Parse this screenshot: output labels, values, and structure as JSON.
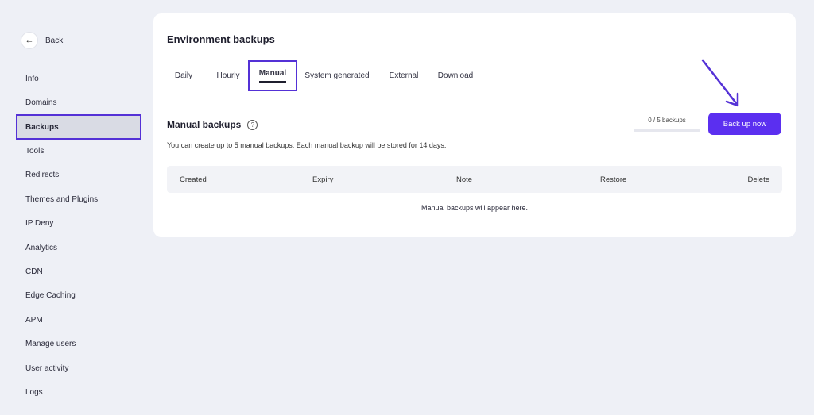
{
  "sidebar": {
    "back_label": "Back",
    "items": [
      {
        "label": "Info"
      },
      {
        "label": "Domains"
      },
      {
        "label": "Backups"
      },
      {
        "label": "Tools"
      },
      {
        "label": "Redirects"
      },
      {
        "label": "Themes and Plugins"
      },
      {
        "label": "IP Deny"
      },
      {
        "label": "Analytics"
      },
      {
        "label": "CDN"
      },
      {
        "label": "Edge Caching"
      },
      {
        "label": "APM"
      },
      {
        "label": "Manage users"
      },
      {
        "label": "User activity"
      },
      {
        "label": "Logs"
      }
    ],
    "active_item": "Backups"
  },
  "main": {
    "title": "Environment backups",
    "tabs": [
      {
        "label": "Daily"
      },
      {
        "label": "Hourly"
      },
      {
        "label": "Manual"
      },
      {
        "label": "System generated"
      },
      {
        "label": "External"
      },
      {
        "label": "Download"
      }
    ],
    "active_tab": "Manual",
    "section_title": "Manual backups",
    "description": "You can create up to 5 manual backups. Each manual backup will be stored for 14 days.",
    "counter_text": "0 / 5 backups",
    "counter_fraction": 0,
    "back_up_button": "Back up now",
    "table": {
      "columns": [
        "Created",
        "Expiry",
        "Note",
        "Restore",
        "Delete"
      ],
      "empty_text": "Manual backups will appear here."
    }
  },
  "colors": {
    "accent": "#5b2ff0",
    "highlight_border": "#5431d6",
    "background": "#eef0f6"
  }
}
